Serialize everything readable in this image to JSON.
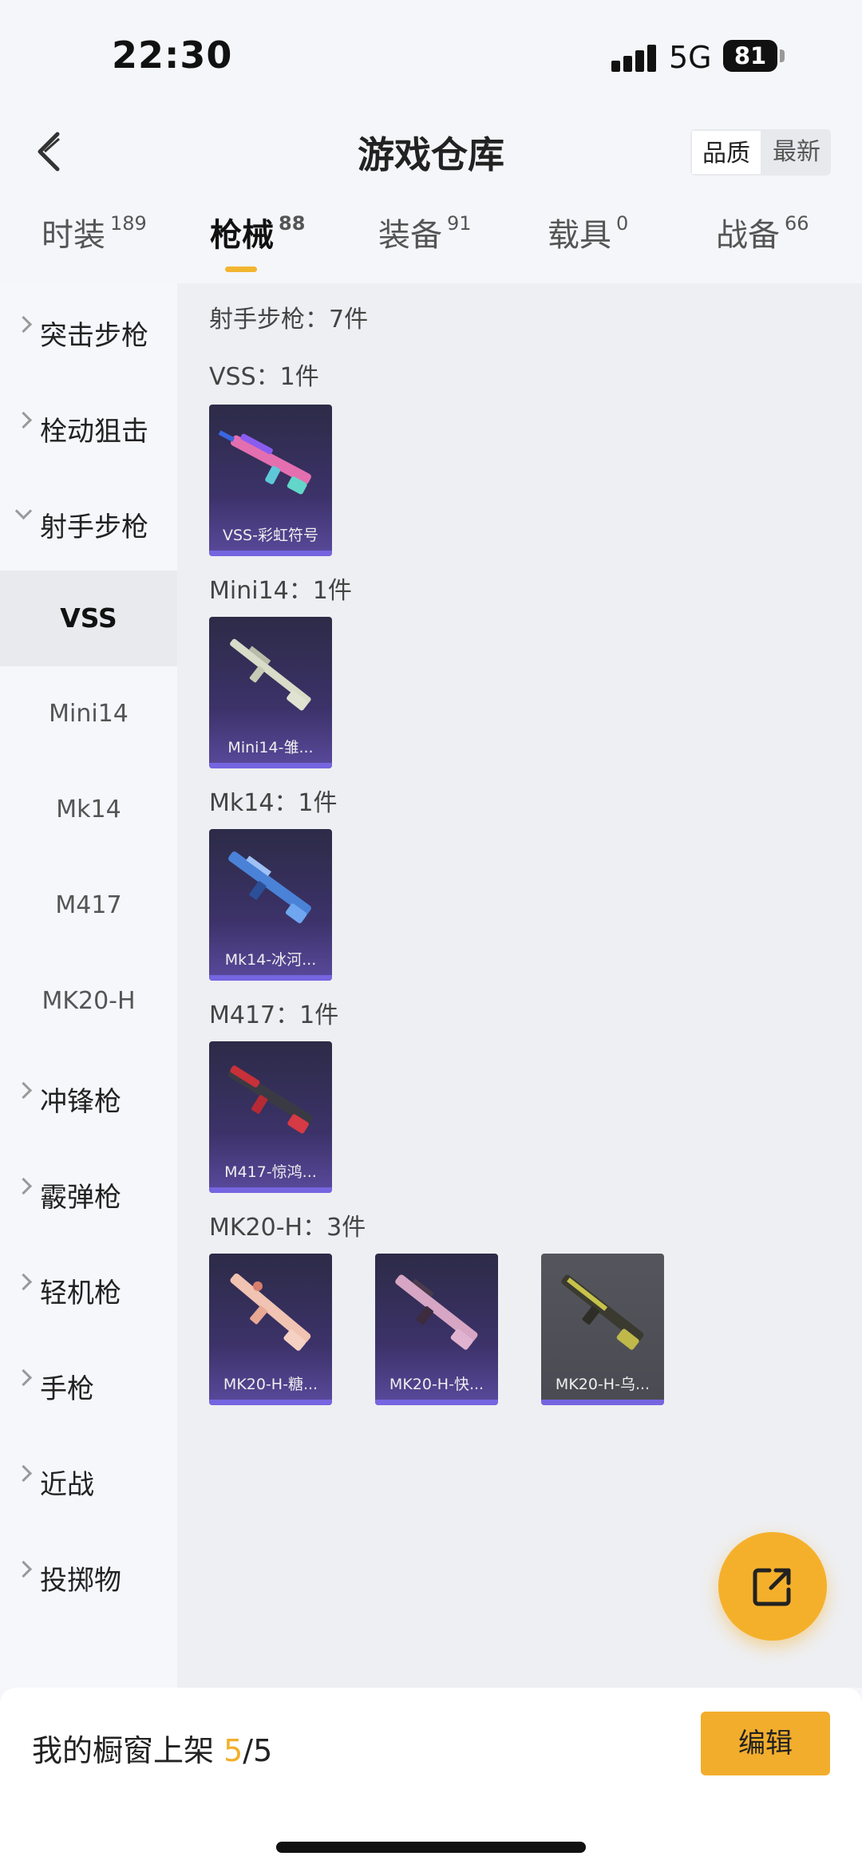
{
  "status": {
    "time": "22:30",
    "network": "5G",
    "battery": "81"
  },
  "header": {
    "title": "游戏仓库",
    "sort_options": [
      "品质",
      "最新"
    ],
    "sort_active": "品质"
  },
  "tabs": [
    {
      "label": "时装",
      "count": "189"
    },
    {
      "label": "枪械",
      "count": "88",
      "active": true
    },
    {
      "label": "装备",
      "count": "91"
    },
    {
      "label": "载具",
      "count": "0"
    },
    {
      "label": "战备",
      "count": "66"
    }
  ],
  "sidebar": {
    "categories": [
      "突击步枪",
      "栓动狙击",
      "射手步枪",
      "冲锋枪",
      "霰弹枪",
      "轻机枪",
      "手枪",
      "近战",
      "投掷物"
    ],
    "subitems": [
      "VSS",
      "Mini14",
      "Mk14",
      "M417",
      "MK20-H"
    ],
    "active_sub": "VSS"
  },
  "content": {
    "total_label": "射手步枪：7件",
    "sections": [
      {
        "label": "VSS：1件",
        "items": [
          {
            "name": "VSS-彩虹符号"
          }
        ]
      },
      {
        "label": "Mini14：1件",
        "items": [
          {
            "name": "Mini14-雏..."
          }
        ]
      },
      {
        "label": "Mk14：1件",
        "items": [
          {
            "name": "Mk14-冰河..."
          }
        ]
      },
      {
        "label": "M417：1件",
        "items": [
          {
            "name": "M417-惊鸿..."
          }
        ]
      },
      {
        "label": "MK20-H：3件",
        "items": [
          {
            "name": "MK20-H-糖..."
          },
          {
            "name": "MK20-H-快..."
          },
          {
            "name": "MK20-H-乌..."
          }
        ]
      }
    ]
  },
  "bottom": {
    "showcase_label": "我的橱窗上架",
    "showcase_current": "5",
    "showcase_total": "/5",
    "edit_label": "编辑"
  },
  "colors": {
    "accent": "#f2ad2c",
    "card_purple": "#3c3269",
    "card_gray": "#4a4b52"
  }
}
